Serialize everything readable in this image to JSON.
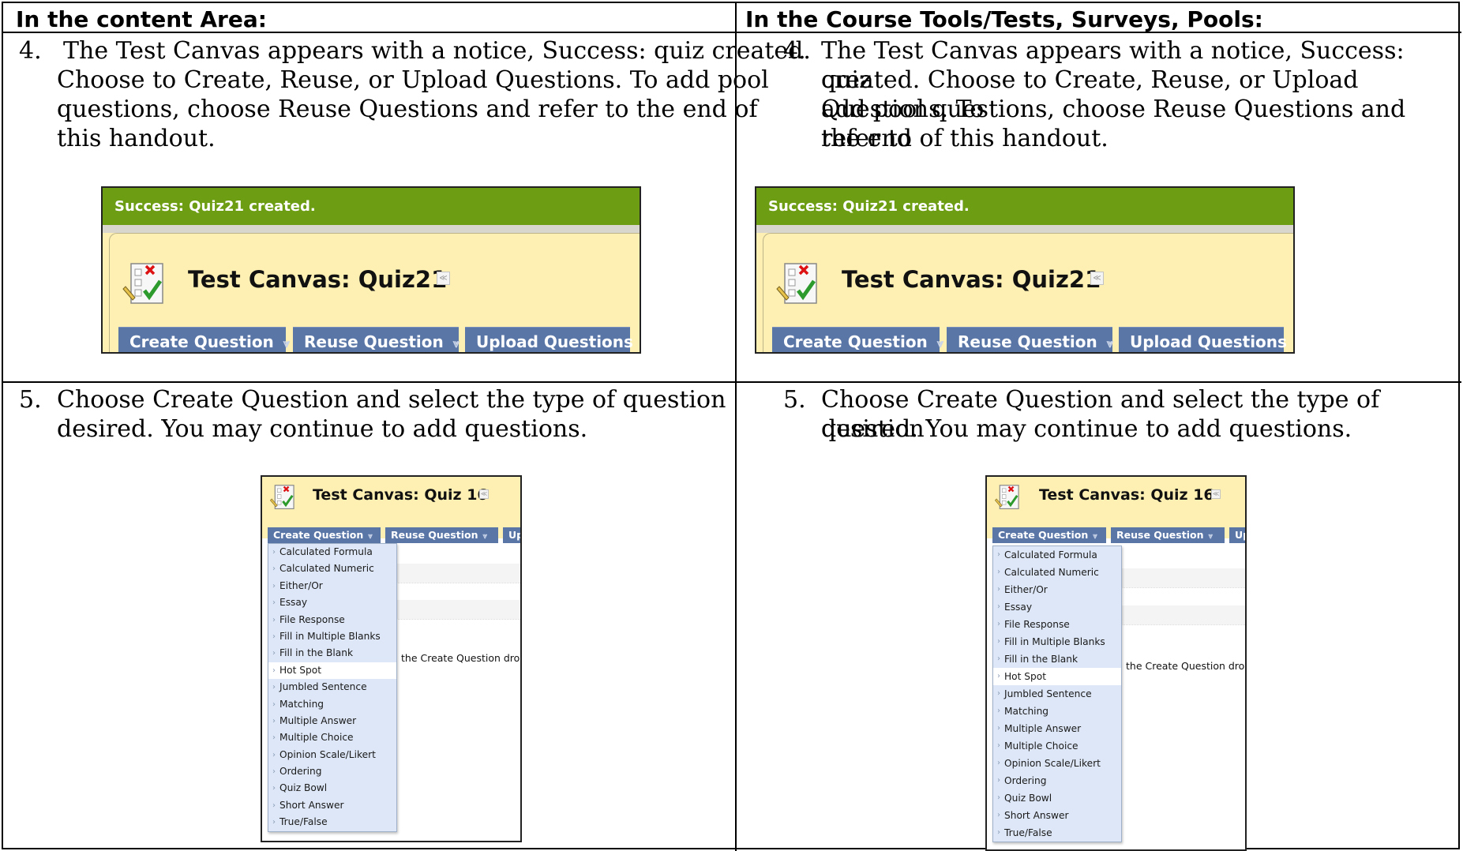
{
  "columns": [
    {
      "header": "In the content Area:"
    },
    {
      "header": "In the Course Tools/Tests, Surveys, Pools:"
    }
  ],
  "steps": {
    "step4": {
      "number": "4.",
      "left_lines": [
        "The Test Canvas appears with a notice, Success: quiz created.",
        "Choose to Create, Reuse, or Upload Questions. To add pool",
        "questions, choose Reuse Questions and refer to the end of",
        "this handout."
      ],
      "right_lines": [
        "The Test Canvas appears with a notice, Success: quiz",
        "created. Choose to Create, Reuse, or Upload Questions. To",
        "add pool questions, choose Reuse Questions and refer to",
        "the end of this handout."
      ]
    },
    "step5": {
      "number": "5.",
      "lines": [
        "Choose Create Question and select the type of question",
        "desired. You may continue to add questions."
      ]
    }
  },
  "canvas_screenshot": {
    "success_notice": "Success: Quiz21 created.",
    "title": "Test Canvas: Quiz21",
    "icon": "test-checklist-icon",
    "buttons": [
      "Create Question",
      "Reuse Question",
      "Upload Questions"
    ],
    "colors": {
      "success": "#6d9d13",
      "panel": "#fdf0b2",
      "button": "#5a76a7"
    }
  },
  "dropdown_screenshot": {
    "title": "Test Canvas: Quiz 16",
    "buttons": [
      "Create Question",
      "Reuse Question",
      "Upl"
    ],
    "hint": "the Create Question drop",
    "menu_items": [
      "Calculated Formula",
      "Calculated Numeric",
      "Either/Or",
      "Essay",
      "File Response",
      "Fill in Multiple Blanks",
      "Fill in the Blank",
      "Hot Spot",
      "Jumbled Sentence",
      "Matching",
      "Multiple Answer",
      "Multiple Choice",
      "Opinion Scale/Likert",
      "Ordering",
      "Quiz Bowl",
      "Short Answer",
      "True/False"
    ],
    "highlighted_item": "Hot Spot"
  }
}
